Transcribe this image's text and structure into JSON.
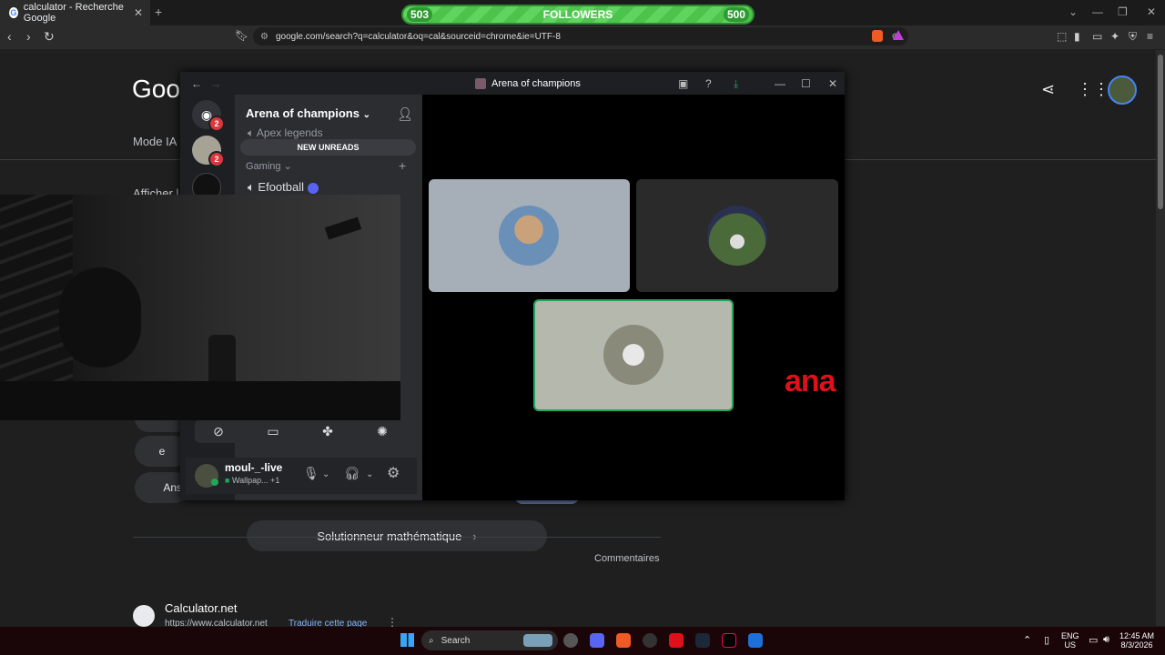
{
  "browser": {
    "tab_title": "calculator - Recherche Google",
    "tab_close": "✕",
    "new_tab": "+",
    "url": "google.com/search?q=calculator&oq=cal&sourceid=chrome&ie=UTF-8",
    "win_controls": [
      "⌄",
      "—",
      "❐",
      "✕"
    ]
  },
  "followers_bar": {
    "left": "503",
    "label": "FOLLOWERS",
    "right": "500"
  },
  "google": {
    "logo": "Goog",
    "mode_ia": "Mode IA",
    "afficher": "Afficher l",
    "e_btn": "e",
    "ans_btn": "Ans",
    "solver": "Solutionneur mathématique",
    "commentaires": "Commentaires",
    "result_title": "Calculator.net",
    "result_url": "https://www.calculator.net",
    "translate": "Traduire cette page"
  },
  "discord": {
    "window_title": "Arena of champions",
    "server_name": "Arena of champions",
    "badge_1": "2",
    "badge_2": "2",
    "channel_top": "Apex legends",
    "new_unreads": "NEW UNREADS",
    "category": "Gaming",
    "channel_efootball": "Efootball",
    "overlay_text": "ana",
    "user_name": "moul-_-live",
    "user_status": "Wallpap...",
    "user_extra": "+1"
  },
  "taskbar": {
    "search": "Search",
    "lang_1": "ENG",
    "lang_2": "US",
    "time": "12:45 AM",
    "date": "8/3/2026"
  }
}
